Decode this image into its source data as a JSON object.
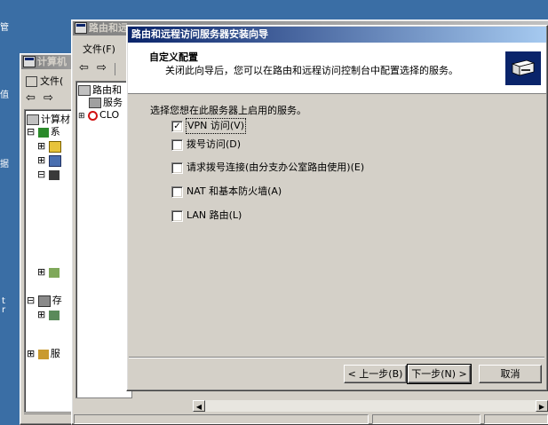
{
  "desktop": {
    "labels": [
      "管",
      "值",
      "据",
      "t",
      "r"
    ]
  },
  "computer_mgmt": {
    "title": "计算机",
    "menu": {
      "file": "文件("
    },
    "tree": [
      {
        "label": "计算材",
        "expand": "⊟"
      },
      {
        "label": "系",
        "expand": "⊟"
      },
      {
        "label": "",
        "expand": "⊞"
      },
      {
        "label": "",
        "expand": "⊞"
      },
      {
        "label": "",
        "expand": "⊟"
      },
      {
        "label": "",
        "expand": "⊞"
      },
      {
        "label": "存",
        "expand": "⊟"
      },
      {
        "label": "",
        "expand": "⊞"
      },
      {
        "label": "服",
        "expand": "⊞"
      }
    ]
  },
  "rras": {
    "title": "路由和远",
    "menu": {
      "file": "文件(F)"
    },
    "tree": [
      {
        "label": "路由和"
      },
      {
        "label": "服务"
      },
      {
        "label": "CLO"
      }
    ]
  },
  "wizard": {
    "title": "路由和远程访问服务器安装向导",
    "header": {
      "heading": "自定义配置",
      "subheading": "关闭此向导后，您可以在路由和远程访问控制台中配置选择的服务。"
    },
    "prompt": "选择您想在此服务器上启用的服务。",
    "options": [
      {
        "label": "VPN 访问(V)",
        "checked": true
      },
      {
        "label": "拨号访问(D)",
        "checked": false
      },
      {
        "label": "请求拨号连接(由分支办公室路由使用)(E)",
        "checked": false
      },
      {
        "label": "NAT 和基本防火墙(A)",
        "checked": false
      },
      {
        "label": "LAN 路由(L)",
        "checked": false
      }
    ],
    "buttons": {
      "back": "< 上一步(B)",
      "next": "下一步(N) >",
      "cancel": "取消"
    },
    "check_mark": "✓"
  },
  "colors": {
    "desktop": "#3a6ea5",
    "active_title": "#0a246a",
    "face": "#d4d0c8"
  }
}
